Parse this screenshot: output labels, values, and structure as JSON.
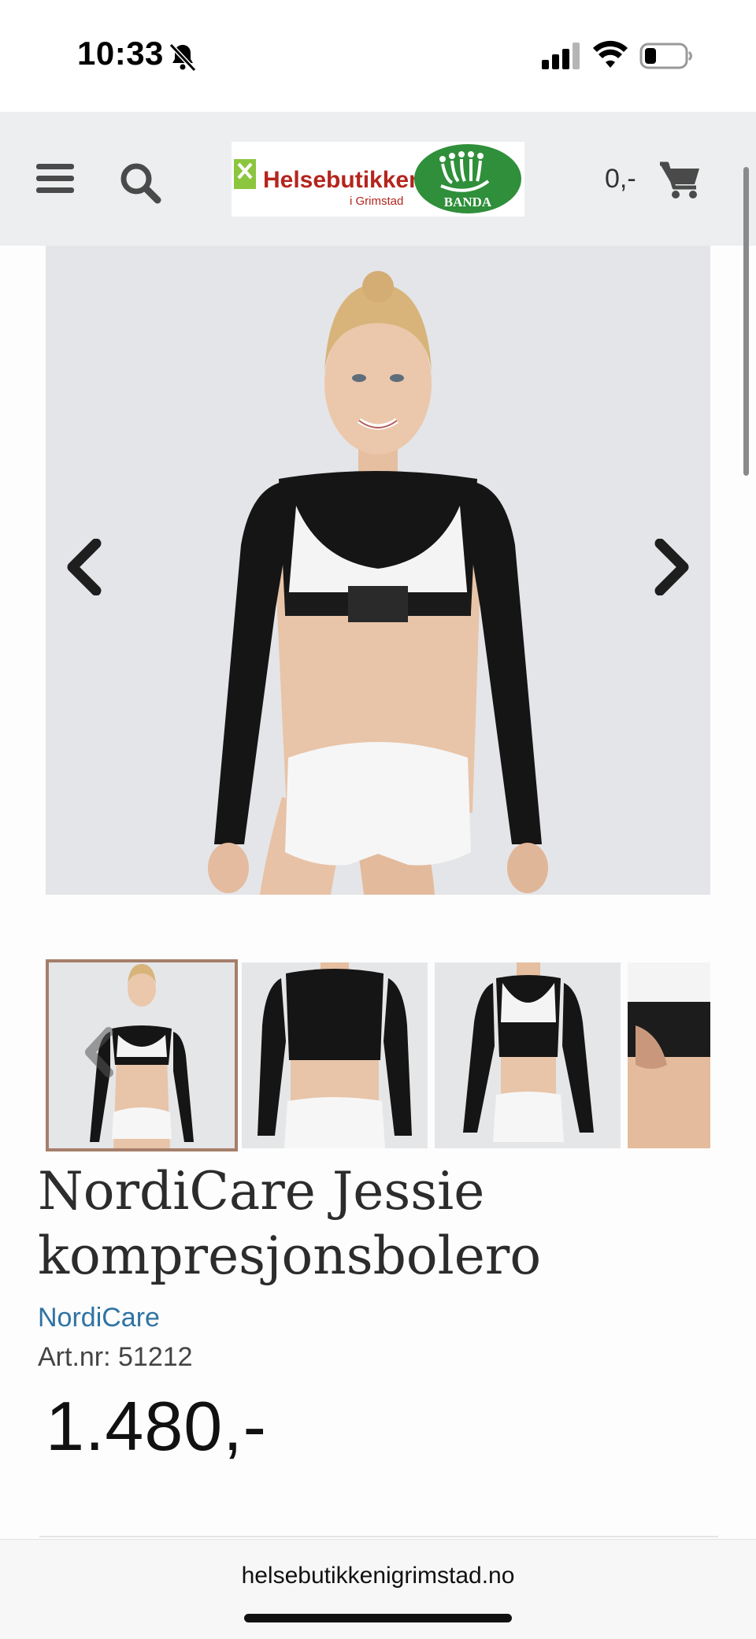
{
  "status_bar": {
    "time": "10:33",
    "icons": [
      "bell-muted-icon",
      "cellular-signal-icon",
      "wifi-icon",
      "battery-icon"
    ]
  },
  "header": {
    "logo": {
      "name": "Helsebutikken",
      "sub": "i Grimstad",
      "partner": "BANDA",
      "colors": {
        "red": "#b3261e",
        "green": "#2f8f3a",
        "leaf": "#8cc63f"
      }
    },
    "cart_total": "0,-",
    "icons": [
      "menu-icon",
      "search-icon",
      "cart-icon"
    ]
  },
  "gallery": {
    "main_alt": "NordiCare Jessie kompresjonsbolero",
    "thumbnails": 4,
    "active_index": 0
  },
  "product": {
    "title": "NordiCare Jessie kompresjonsbolero",
    "brand": "NordiCare",
    "art_nr": "Art.nr: 51212",
    "price": "1.480,-"
  },
  "browser": {
    "url": "helsebutikkenigrimstad.no"
  },
  "colors": {
    "header_bg": "#eceeef",
    "image_bg": "#e4e5e8",
    "brand_link": "#2f73a4",
    "thumb_active_border": "#a57e6a"
  }
}
